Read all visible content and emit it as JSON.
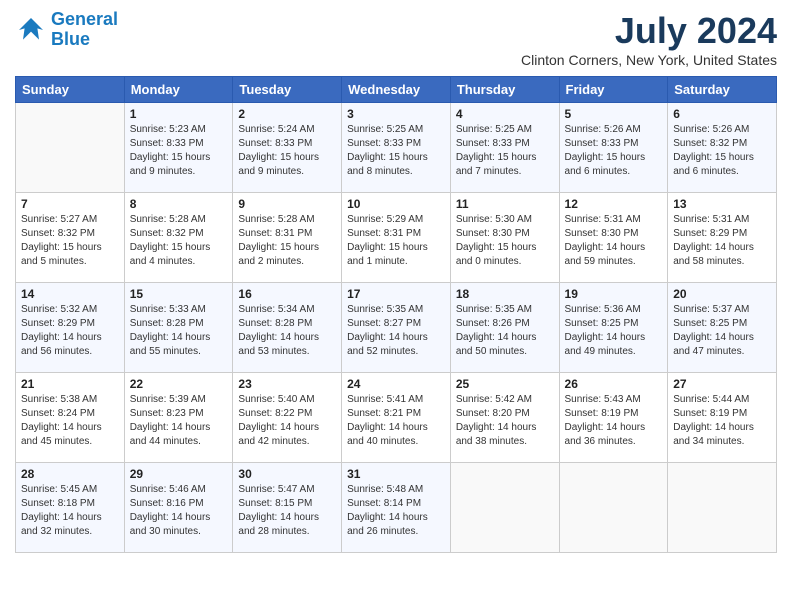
{
  "header": {
    "logo_line1": "General",
    "logo_line2": "Blue",
    "month": "July 2024",
    "location": "Clinton Corners, New York, United States"
  },
  "weekdays": [
    "Sunday",
    "Monday",
    "Tuesday",
    "Wednesday",
    "Thursday",
    "Friday",
    "Saturday"
  ],
  "weeks": [
    [
      {
        "day": "",
        "info": ""
      },
      {
        "day": "1",
        "info": "Sunrise: 5:23 AM\nSunset: 8:33 PM\nDaylight: 15 hours\nand 9 minutes."
      },
      {
        "day": "2",
        "info": "Sunrise: 5:24 AM\nSunset: 8:33 PM\nDaylight: 15 hours\nand 9 minutes."
      },
      {
        "day": "3",
        "info": "Sunrise: 5:25 AM\nSunset: 8:33 PM\nDaylight: 15 hours\nand 8 minutes."
      },
      {
        "day": "4",
        "info": "Sunrise: 5:25 AM\nSunset: 8:33 PM\nDaylight: 15 hours\nand 7 minutes."
      },
      {
        "day": "5",
        "info": "Sunrise: 5:26 AM\nSunset: 8:33 PM\nDaylight: 15 hours\nand 6 minutes."
      },
      {
        "day": "6",
        "info": "Sunrise: 5:26 AM\nSunset: 8:32 PM\nDaylight: 15 hours\nand 6 minutes."
      }
    ],
    [
      {
        "day": "7",
        "info": "Sunrise: 5:27 AM\nSunset: 8:32 PM\nDaylight: 15 hours\nand 5 minutes."
      },
      {
        "day": "8",
        "info": "Sunrise: 5:28 AM\nSunset: 8:32 PM\nDaylight: 15 hours\nand 4 minutes."
      },
      {
        "day": "9",
        "info": "Sunrise: 5:28 AM\nSunset: 8:31 PM\nDaylight: 15 hours\nand 2 minutes."
      },
      {
        "day": "10",
        "info": "Sunrise: 5:29 AM\nSunset: 8:31 PM\nDaylight: 15 hours\nand 1 minute."
      },
      {
        "day": "11",
        "info": "Sunrise: 5:30 AM\nSunset: 8:30 PM\nDaylight: 15 hours\nand 0 minutes."
      },
      {
        "day": "12",
        "info": "Sunrise: 5:31 AM\nSunset: 8:30 PM\nDaylight: 14 hours\nand 59 minutes."
      },
      {
        "day": "13",
        "info": "Sunrise: 5:31 AM\nSunset: 8:29 PM\nDaylight: 14 hours\nand 58 minutes."
      }
    ],
    [
      {
        "day": "14",
        "info": "Sunrise: 5:32 AM\nSunset: 8:29 PM\nDaylight: 14 hours\nand 56 minutes."
      },
      {
        "day": "15",
        "info": "Sunrise: 5:33 AM\nSunset: 8:28 PM\nDaylight: 14 hours\nand 55 minutes."
      },
      {
        "day": "16",
        "info": "Sunrise: 5:34 AM\nSunset: 8:28 PM\nDaylight: 14 hours\nand 53 minutes."
      },
      {
        "day": "17",
        "info": "Sunrise: 5:35 AM\nSunset: 8:27 PM\nDaylight: 14 hours\nand 52 minutes."
      },
      {
        "day": "18",
        "info": "Sunrise: 5:35 AM\nSunset: 8:26 PM\nDaylight: 14 hours\nand 50 minutes."
      },
      {
        "day": "19",
        "info": "Sunrise: 5:36 AM\nSunset: 8:25 PM\nDaylight: 14 hours\nand 49 minutes."
      },
      {
        "day": "20",
        "info": "Sunrise: 5:37 AM\nSunset: 8:25 PM\nDaylight: 14 hours\nand 47 minutes."
      }
    ],
    [
      {
        "day": "21",
        "info": "Sunrise: 5:38 AM\nSunset: 8:24 PM\nDaylight: 14 hours\nand 45 minutes."
      },
      {
        "day": "22",
        "info": "Sunrise: 5:39 AM\nSunset: 8:23 PM\nDaylight: 14 hours\nand 44 minutes."
      },
      {
        "day": "23",
        "info": "Sunrise: 5:40 AM\nSunset: 8:22 PM\nDaylight: 14 hours\nand 42 minutes."
      },
      {
        "day": "24",
        "info": "Sunrise: 5:41 AM\nSunset: 8:21 PM\nDaylight: 14 hours\nand 40 minutes."
      },
      {
        "day": "25",
        "info": "Sunrise: 5:42 AM\nSunset: 8:20 PM\nDaylight: 14 hours\nand 38 minutes."
      },
      {
        "day": "26",
        "info": "Sunrise: 5:43 AM\nSunset: 8:19 PM\nDaylight: 14 hours\nand 36 minutes."
      },
      {
        "day": "27",
        "info": "Sunrise: 5:44 AM\nSunset: 8:19 PM\nDaylight: 14 hours\nand 34 minutes."
      }
    ],
    [
      {
        "day": "28",
        "info": "Sunrise: 5:45 AM\nSunset: 8:18 PM\nDaylight: 14 hours\nand 32 minutes."
      },
      {
        "day": "29",
        "info": "Sunrise: 5:46 AM\nSunset: 8:16 PM\nDaylight: 14 hours\nand 30 minutes."
      },
      {
        "day": "30",
        "info": "Sunrise: 5:47 AM\nSunset: 8:15 PM\nDaylight: 14 hours\nand 28 minutes."
      },
      {
        "day": "31",
        "info": "Sunrise: 5:48 AM\nSunset: 8:14 PM\nDaylight: 14 hours\nand 26 minutes."
      },
      {
        "day": "",
        "info": ""
      },
      {
        "day": "",
        "info": ""
      },
      {
        "day": "",
        "info": ""
      }
    ]
  ]
}
